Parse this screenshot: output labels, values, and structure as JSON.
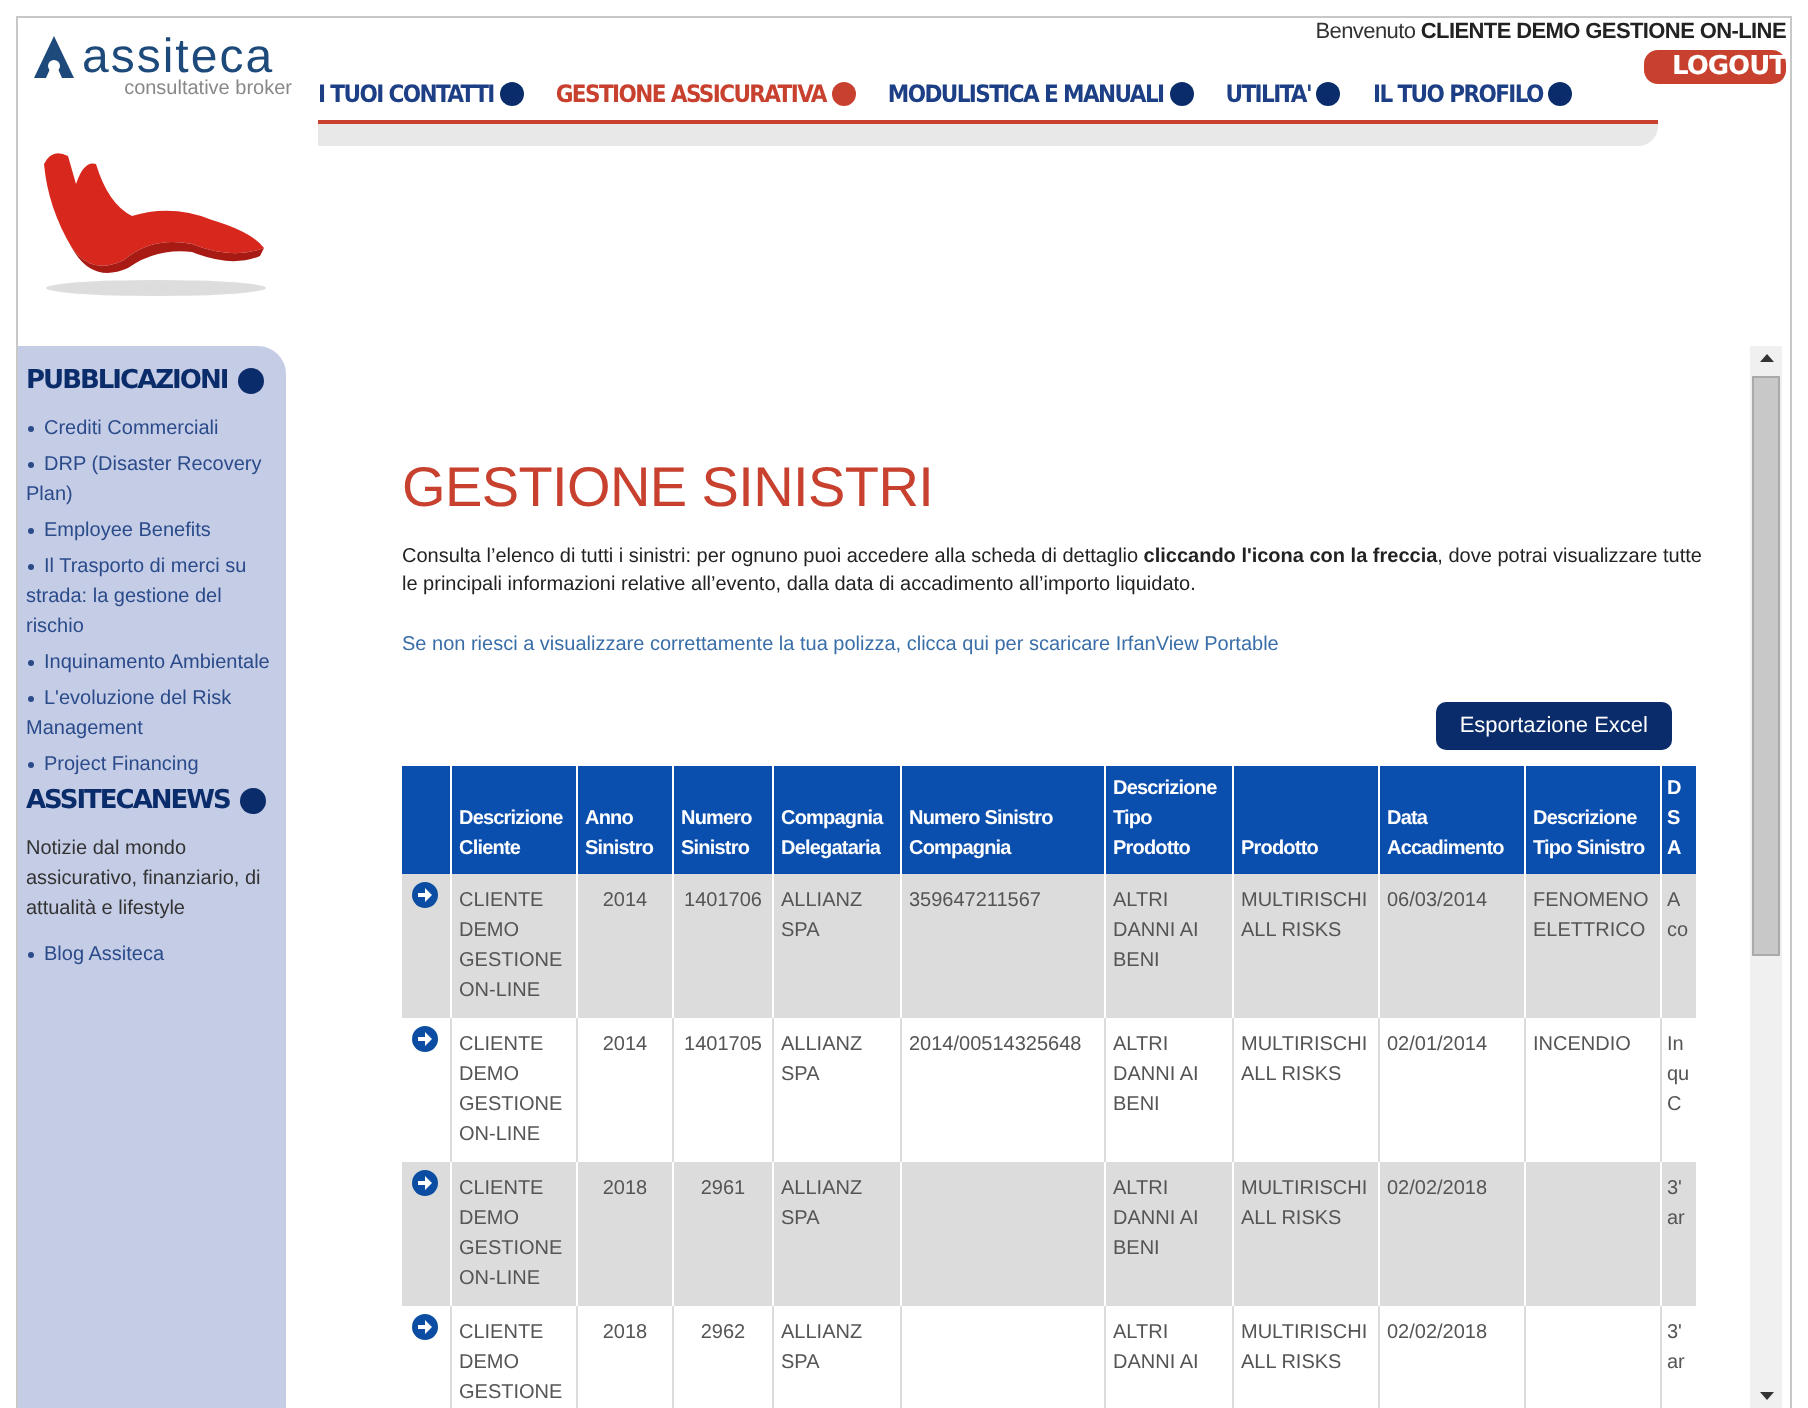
{
  "header": {
    "logo": {
      "name": "assiteca",
      "tagline": "consultative broker"
    },
    "greeting": "Benvenuto",
    "user_name": "CLIENTE DEMO GESTIONE ON-LINE",
    "logout": "LOGOUT"
  },
  "nav": [
    {
      "label": "I TUOI CONTATTI",
      "selected": false
    },
    {
      "label": "GESTIONE ASSICURATIVA",
      "selected": true
    },
    {
      "label": "MODULISTICA E MANUALI",
      "selected": false
    },
    {
      "label": "UTILITA'",
      "selected": false
    },
    {
      "label": "IL TUO PROFILO",
      "selected": false
    }
  ],
  "sidebar": {
    "sections": [
      {
        "title": "PUBBLICAZIONI",
        "items": [
          "Crediti Commerciali",
          "DRP (Disaster Recovery Plan)",
          "Employee Benefits",
          "Il Trasporto di merci su strada: la gestione del rischio",
          "Inquinamento Ambientale",
          "L'evoluzione del Risk Management",
          "Project Financing"
        ]
      },
      {
        "title": "ASSITECANEWS",
        "description": "Notizie dal mondo assicurativo, finanziario, di attualità e lifestyle",
        "items": [
          "Blog Assiteca"
        ]
      }
    ]
  },
  "main": {
    "title": "GESTIONE SINISTRI",
    "intro": "Consulta l’elenco di tutti i sinistri: per ognuno puoi accedere alla scheda di dettaglio **cliccando l'icona con la freccia**, dove potrai visualizzare tutte le principali informazioni relative all’evento, dalla data di accadimento all’importo liquidato.",
    "link": "Se non riesci a visualizzare correttamente la tua polizza, clicca qui per scaricare IrfanView Portable",
    "export_button": "Esportazione Excel",
    "table": {
      "columns": [
        "Descrizione Cliente",
        "Anno Sinistro",
        "Numero Sinistro",
        "Compagnia Delegataria",
        "Numero Sinistro Compagnia",
        "Descrizione Tipo Prodotto",
        "Prodotto",
        "Data Accadimento",
        "Descrizione Tipo Sinistro",
        "D S A"
      ],
      "rows": [
        {
          "cells": [
            "CLIENTE DEMO GESTIONE ON-LINE",
            "2014",
            "1401706",
            "ALLIANZ SPA",
            "359647211567",
            "ALTRI DANNI AI BENI",
            "MULTIRISCHI ALL RISKS",
            "06/03/2014",
            "FENOMENO ELETTRICO",
            "A co"
          ]
        },
        {
          "cells": [
            "CLIENTE DEMO GESTIONE ON-LINE",
            "2014",
            "1401705",
            "ALLIANZ SPA",
            "2014/00514325648",
            "ALTRI DANNI AI BENI",
            "MULTIRISCHI ALL RISKS",
            "02/01/2014",
            "INCENDIO",
            "In qu C"
          ]
        },
        {
          "cells": [
            "CLIENTE DEMO GESTIONE ON-LINE",
            "2018",
            "2961",
            "ALLIANZ SPA",
            "",
            "ALTRI DANNI AI BENI",
            "MULTIRISCHI ALL RISKS",
            "02/02/2018",
            "",
            "3' ar"
          ]
        },
        {
          "cells": [
            "CLIENTE DEMO GESTIONE",
            "2018",
            "2962",
            "ALLIANZ SPA",
            "",
            "ALTRI DANNI AI",
            "MULTIRISCHI ALL RISKS",
            "02/02/2018",
            "",
            "3' ar"
          ]
        }
      ]
    }
  }
}
